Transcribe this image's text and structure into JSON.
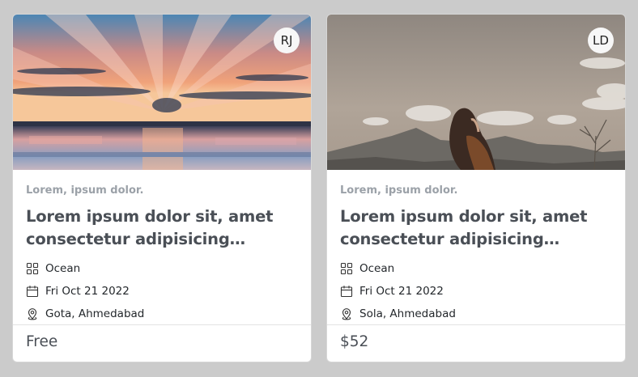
{
  "cards": [
    {
      "avatar_initials": "RJ",
      "subtitle": "Lorem, ipsum dolor.",
      "title": "Lorem ipsum dolor sit, amet consectetur adipisicing…",
      "category": "Ocean",
      "date": "Fri Oct 21 2022",
      "location": "Gota, Ahmedabad",
      "price": "Free",
      "image": "sunset-over-ocean"
    },
    {
      "avatar_initials": "LD",
      "subtitle": "Lorem, ipsum dolor.",
      "title": "Lorem ipsum dolor sit, amet consectetur adipisicing…",
      "category": "Ocean",
      "date": "Fri Oct 21 2022",
      "location": "Sola, Ahmedabad",
      "price": "$52",
      "image": "woman-on-mountain"
    }
  ],
  "icons": {
    "category": "grid-icon",
    "date": "calendar-icon",
    "location": "map-pin-icon"
  },
  "colors": {
    "page_bg": "#cbcbcb",
    "title": "#4a4f56",
    "subtitle": "#9ba1a8"
  }
}
